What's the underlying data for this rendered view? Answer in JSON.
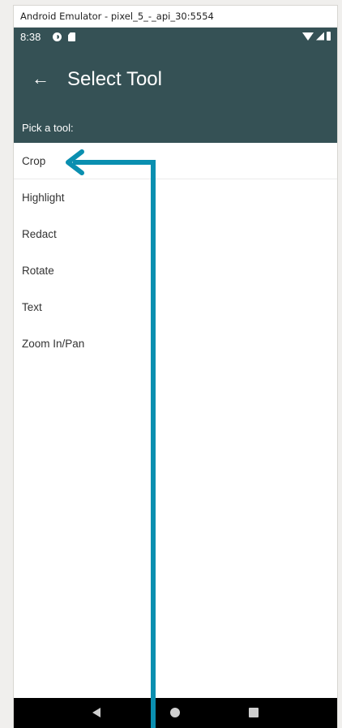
{
  "window": {
    "title": "Android Emulator - pixel_5_-_api_30:5554"
  },
  "status_bar": {
    "time": "8:38"
  },
  "app_bar": {
    "back_glyph": "←",
    "title": "Select Tool"
  },
  "subheader": {
    "label": "Pick a tool:"
  },
  "tools": {
    "items": [
      {
        "label": "Crop"
      },
      {
        "label": "Highlight"
      },
      {
        "label": "Redact"
      },
      {
        "label": "Rotate"
      },
      {
        "label": "Text"
      },
      {
        "label": "Zoom In/Pan"
      }
    ]
  },
  "colors": {
    "app_bar": "#355155",
    "annotation_arrow": "#0a8fb0",
    "nav_bar": "#000000"
  },
  "icons": [
    "back-arrow-icon",
    "nav-back-icon",
    "nav-home-icon",
    "nav-recent-icon",
    "wifi-icon",
    "signal-icon",
    "battery-icon"
  ]
}
